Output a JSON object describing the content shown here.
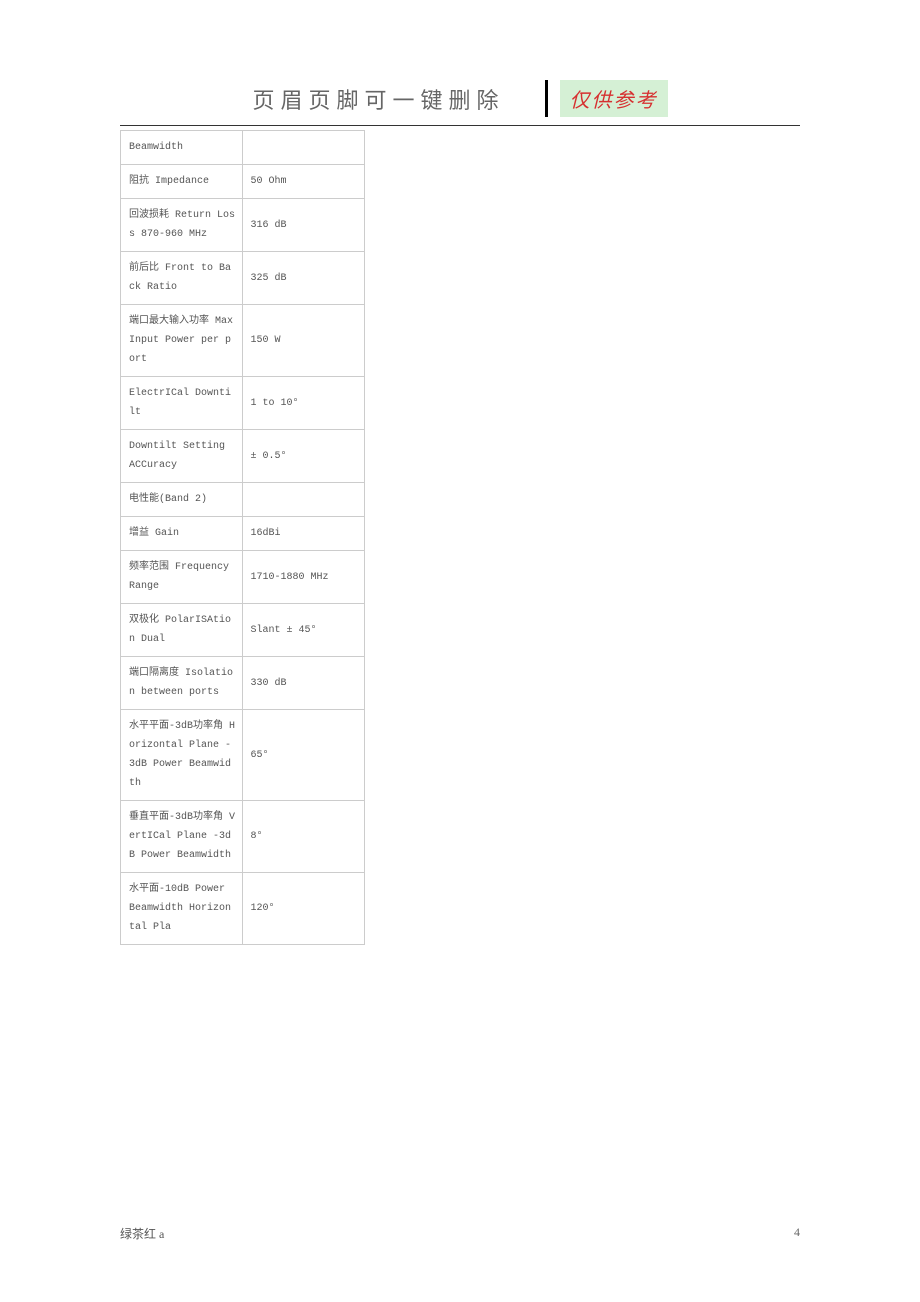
{
  "header": {
    "title": "页眉页脚可一键删除",
    "badge": "仅供参考"
  },
  "rows": [
    {
      "label": "Beamwidth",
      "value": ""
    },
    {
      "label": "阻抗 Impedance",
      "value": "50 Ohm"
    },
    {
      "label": "回波损耗 Return Loss 870-960 MHz",
      "value": "316 dB"
    },
    {
      "label": "前后比 Front to Back Ratio",
      "value": "325 dB"
    },
    {
      "label": "端口最大输入功率 Max Input Power per port",
      "value": "150 W"
    },
    {
      "label": "ElectrICal Downtilt",
      "value": "1 to 10°"
    },
    {
      "label": "Downtilt Setting ACCuracy",
      "value": "± 0.5°"
    },
    {
      "label": "电性能(Band 2)",
      "value": ""
    },
    {
      "label": "增益 Gain",
      "value": "16dBi"
    },
    {
      "label": "频率范围 Frequency Range",
      "value": "1710-1880 MHz"
    },
    {
      "label": "双极化 PolarISAtion Dual",
      "value": "Slant ± 45°"
    },
    {
      "label": "端口隔离度 Isolation between ports",
      "value": "330 dB"
    },
    {
      "label": "水平平面-3dB功率角\nHorizontal Plane -3dB Power Beamwidth",
      "value": "65°"
    },
    {
      "label": "垂直平面-3dB功率角\nVertICal Plane -3dB Power Beamwidth",
      "value": "8°"
    },
    {
      "label": "水平面-10dB Power Beamwidth Horizontal Pla",
      "value": "120°"
    }
  ],
  "footer": {
    "left": "绿茶红 a",
    "right": "4"
  }
}
